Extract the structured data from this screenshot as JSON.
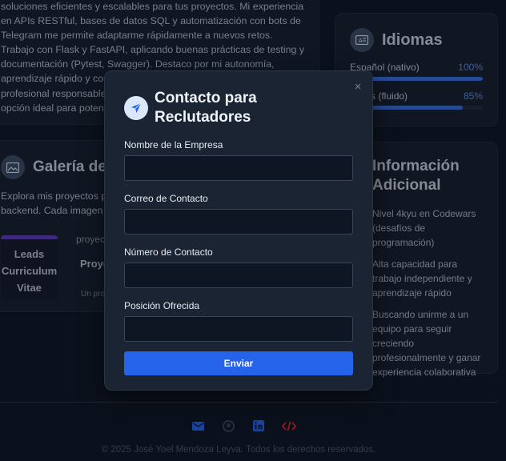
{
  "about": {
    "text": "soluciones eficientes y escalables para tus proyectos. Mi experiencia en APIs RESTful, bases de datos SQL y automatización con bots de Telegram me permite adaptarme rápidamente a nuevos retos. Trabajo con Flask y FastAPI, aplicando buenas prácticas de testing y documentación (Pytest, Swagger). Destaco por mi autonomía, aprendizaje rápido y compromiso con la calidad. Si buscas un profesional responsable, proactivo y con ganas de crecer, soy la opción ideal para potenciar tu equipo."
  },
  "languages": {
    "title": "Idiomas",
    "icon": "language-icon",
    "items": [
      {
        "name": "Español (nativo)",
        "percent": "100%",
        "level": 1.0
      },
      {
        "name": "Inglés (fluido)",
        "percent": "85%",
        "level": 0.85
      }
    ]
  },
  "gallery": {
    "title": "Galería de Proyectos",
    "description": "Explora mis proyectos personales de desarrollo backend. Cada imagen representa un proyecto.",
    "thumb_label": "Leads Curriculum Vitae",
    "project_subtitle": "proyecto",
    "project_title": "Proyecto Ejemplo",
    "project_desc": "Un proyecto"
  },
  "info": {
    "title": "Información Adicional",
    "items": [
      "Nivel 4kyu en Codewars (desafíos de programación)",
      "Alta capacidad para trabajo independiente y aprendizaje rápido",
      "Buscando unirme a un equipo para seguir creciendo profesionalmente y ganar experiencia colaborativa"
    ]
  },
  "footer": {
    "icons": [
      "email-icon",
      "github-icon",
      "linkedin-icon",
      "code-icon"
    ],
    "colors": {
      "email": "#2563eb",
      "github": "#3b4454",
      "linkedin": "#2563eb",
      "code": "#dc2626"
    },
    "copyright": "© 2025 José Yoel Mendoza Leyva. Todos los derechos reservados."
  },
  "modal": {
    "title": "Contacto para Reclutadores",
    "close_label": "×",
    "icon": "paper-plane-icon",
    "fields": [
      {
        "label": "Nombre de la Empresa",
        "value": "",
        "placeholder": ""
      },
      {
        "label": "Correo de Contacto",
        "value": "",
        "placeholder": ""
      },
      {
        "label": "Número de Contacto",
        "value": "",
        "placeholder": ""
      },
      {
        "label": "Posición Ofrecida",
        "value": "",
        "placeholder": ""
      }
    ],
    "submit_label": "Enviar",
    "accent": "#2563eb"
  }
}
